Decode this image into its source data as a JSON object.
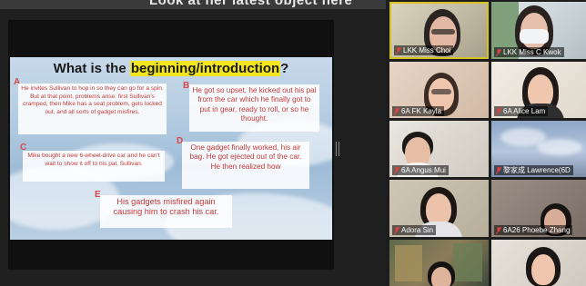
{
  "header": {
    "cut_text": "Look at her latest object here"
  },
  "slide": {
    "title_before": "What is the ",
    "title_highlight": "beginning/introduction",
    "title_after": "?",
    "cards": [
      {
        "letter": "A",
        "text": "He invites Sullivan to hop in so they can go for a spin.  But at that point, problems arise: first Sullivan's cramped, then Mike has a seat problem, gets locked out, and all sorts of gadget misfires."
      },
      {
        "letter": "B",
        "text": "He got so upset, he kicked out his pal from the car which he finally got to put in gear, ready to roll, or so he thought."
      },
      {
        "letter": "C",
        "text": "Mike bought a new 6-wheel-drive car and he can't wait to show it off to his pal, Sullivan."
      },
      {
        "letter": "D",
        "text": "One gadget finally worked, his air bag.  He got ejected out of the car. He then realized how"
      },
      {
        "letter": "E",
        "text": "His gadgets misfired again causing him to crash his car."
      }
    ]
  },
  "participants": [
    {
      "name": "LKK Miss Choi",
      "muted": true
    },
    {
      "name": "LKK Miss C Kwok",
      "muted": true
    },
    {
      "name": "6A FK Kayla",
      "muted": true
    },
    {
      "name": "6A Alice Lam",
      "muted": true
    },
    {
      "name": "6A Angus Mui",
      "muted": true
    },
    {
      "name": "黎家成 Lawrence(6D",
      "muted": true
    },
    {
      "name": "Adora Sin",
      "muted": true
    },
    {
      "name": "6A26 Phoebe Zhang",
      "muted": true
    },
    {
      "name": "",
      "muted": false
    },
    {
      "name": "",
      "muted": false
    }
  ],
  "colors": {
    "active_speaker": "#d6c320",
    "highlight": "#f3e51f",
    "card_text": "#c33a3a"
  },
  "icons": {
    "tile_status": "mic-muted-icon"
  }
}
